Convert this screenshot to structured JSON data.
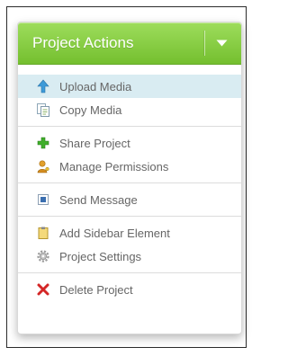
{
  "header": {
    "title": "Project Actions",
    "caret_icon": "chevron-down-icon",
    "color_top": "#9edd5d",
    "color_bottom": "#74bf2f"
  },
  "menu": {
    "items": [
      {
        "label": "Upload Media",
        "icon": "arrow-up-icon",
        "active": true
      },
      {
        "label": "Copy Media",
        "icon": "copy-document-icon"
      },
      {
        "label": "Share Project",
        "icon": "plus-icon"
      },
      {
        "label": "Manage Permissions",
        "icon": "user-key-icon"
      },
      {
        "label": "Send Message",
        "icon": "message-icon"
      },
      {
        "label": "Add Sidebar Element",
        "icon": "clipboard-icon"
      },
      {
        "label": "Project Settings",
        "icon": "gear-icon"
      },
      {
        "label": "Delete Project",
        "icon": "delete-x-icon"
      }
    ],
    "highlight_color": "#d9ecf2"
  }
}
